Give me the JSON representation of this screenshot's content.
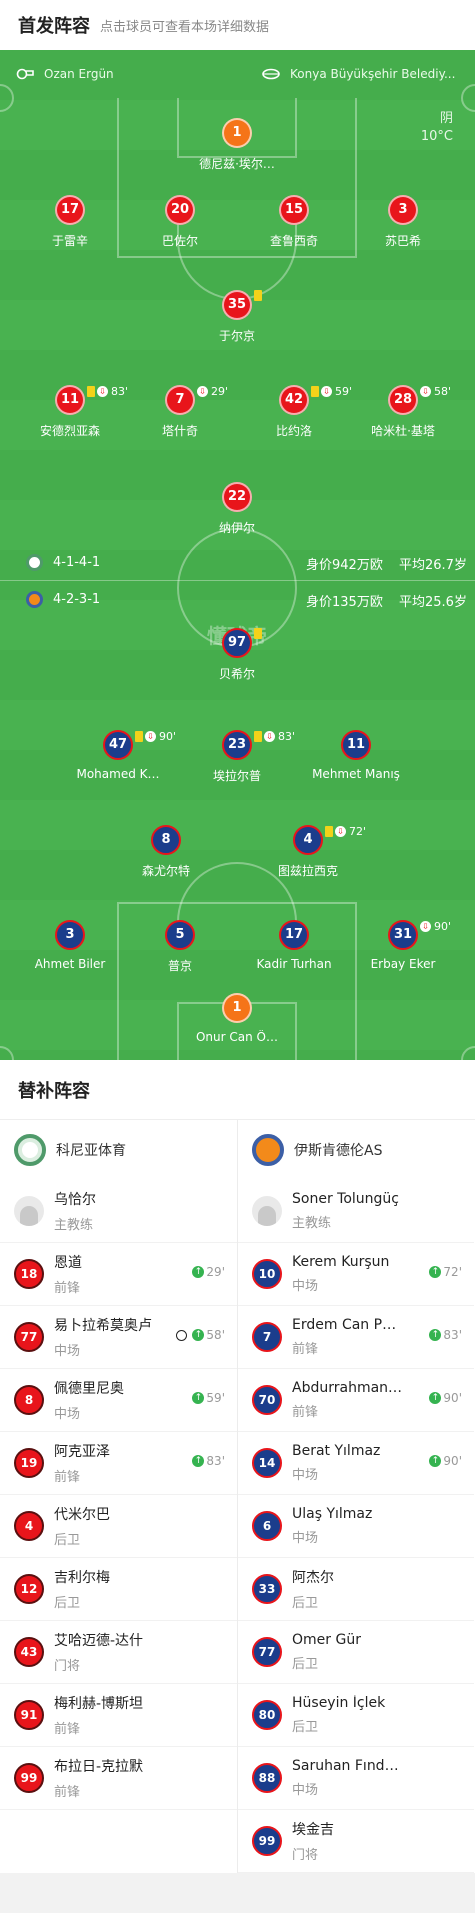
{
  "header": {
    "title": "首发阵容",
    "subtitle": "点击球员可查看本场详细数据"
  },
  "pitch": {
    "home_coach": "Ozan Ergün",
    "away_coach": "Konya Büyükşehir Belediy...",
    "weather": "阴",
    "temperature": "10°C",
    "watermark": "懂球帝",
    "home_formation": "4-1-4-1",
    "home_value": "身价942万欧",
    "home_age": "平均26.7岁",
    "away_formation": "4-2-3-1",
    "away_value": "身价135万欧",
    "away_age": "平均25.6岁"
  },
  "lineup": {
    "home_players": [
      {
        "number": "1",
        "name": "德尼兹·埃尔…",
        "team": "orange"
      },
      {
        "number": "17",
        "name": "于雷辛",
        "team": "red"
      },
      {
        "number": "20",
        "name": "巴佐尔",
        "team": "red"
      },
      {
        "number": "15",
        "name": "查鲁西奇",
        "team": "red",
        "goal": true
      },
      {
        "number": "3",
        "name": "苏巴希",
        "team": "red"
      },
      {
        "number": "35",
        "name": "于尔京",
        "team": "red",
        "yellow": true
      },
      {
        "number": "11",
        "name": "安德烈亚森",
        "team": "red",
        "yellow": true,
        "sub_off": "83'"
      },
      {
        "number": "7",
        "name": "塔什奇",
        "team": "red",
        "sub_off": "29'"
      },
      {
        "number": "42",
        "name": "比约洛",
        "team": "red",
        "yellow": true,
        "sub_off": "59'"
      },
      {
        "number": "28",
        "name": "哈米杜·基塔",
        "team": "red",
        "sub_off": "58'"
      },
      {
        "number": "22",
        "name": "纳伊尔",
        "team": "red",
        "goal": true
      }
    ],
    "away_players": [
      {
        "number": "97",
        "name": "贝希尔",
        "team": "blue",
        "yellow": true
      },
      {
        "number": "47",
        "name": "Mohamed K…",
        "team": "blue",
        "yellow": true,
        "sub_off": "90'"
      },
      {
        "number": "23",
        "name": "埃拉尔普",
        "team": "blue",
        "yellow": true,
        "sub_off": "83'"
      },
      {
        "number": "11",
        "name": "Mehmet Manış",
        "team": "blue"
      },
      {
        "number": "8",
        "name": "森尤尔特",
        "team": "blue"
      },
      {
        "number": "4",
        "name": "图兹拉西克",
        "team": "blue",
        "yellow": true,
        "sub_off": "72'"
      },
      {
        "number": "3",
        "name": "Ahmet Biler",
        "team": "blue"
      },
      {
        "number": "5",
        "name": "普京",
        "team": "blue"
      },
      {
        "number": "17",
        "name": "Kadir Turhan",
        "team": "blue"
      },
      {
        "number": "31",
        "name": "Erbay Eker",
        "team": "blue",
        "sub_off": "90'"
      },
      {
        "number": "1",
        "name": "Onur Can Ö…",
        "team": "orange"
      }
    ]
  },
  "subs": {
    "title": "替补阵容",
    "home": {
      "team_name": "科尼亚体育",
      "coach": {
        "name": "乌恰尔",
        "role": "主教练"
      },
      "players": [
        {
          "number": "18",
          "name": "恩道",
          "position": "前锋",
          "sub_in": "29'"
        },
        {
          "number": "77",
          "name": "易卜拉希莫奥卢",
          "position": "中场",
          "sub_in": "58'",
          "goal": true
        },
        {
          "number": "8",
          "name": "佩德里尼奥",
          "position": "中场",
          "sub_in": "59'"
        },
        {
          "number": "19",
          "name": "阿克亚泽",
          "position": "前锋",
          "sub_in": "83'"
        },
        {
          "number": "4",
          "name": "代米尔巴",
          "position": "后卫"
        },
        {
          "number": "12",
          "name": "吉利尔梅",
          "position": "后卫"
        },
        {
          "number": "43",
          "name": "艾哈迈德-达什",
          "position": "门将"
        },
        {
          "number": "91",
          "name": "梅利赫-博斯坦",
          "position": "前锋"
        },
        {
          "number": "99",
          "name": "布拉日-克拉默",
          "position": "前锋"
        }
      ]
    },
    "away": {
      "team_name": "伊斯肯德伦AS",
      "coach": {
        "name": "Soner Tolungüç",
        "role": "主教练"
      },
      "players": [
        {
          "number": "10",
          "name": "Kerem Kurşun",
          "position": "中场",
          "sub_in": "72'"
        },
        {
          "number": "7",
          "name": "Erdem Can P…",
          "position": "前锋",
          "sub_in": "83'"
        },
        {
          "number": "70",
          "name": "Abdurrahman…",
          "position": "前锋",
          "sub_in": "90'"
        },
        {
          "number": "14",
          "name": "Berat Yılmaz",
          "position": "中场",
          "sub_in": "90'"
        },
        {
          "number": "6",
          "name": "Ulaş Yılmaz",
          "position": "中场"
        },
        {
          "number": "33",
          "name": "阿杰尔",
          "position": "后卫"
        },
        {
          "number": "77",
          "name": "Ömer Gür",
          "position": "后卫"
        },
        {
          "number": "80",
          "name": "Hüseyin İçlek",
          "position": "后卫"
        },
        {
          "number": "88",
          "name": "Saruhan Fınd…",
          "position": "中场"
        },
        {
          "number": "99",
          "name": "埃金吉",
          "position": "门将"
        }
      ]
    }
  },
  "colors": {
    "pitch": "#45ad4c",
    "home": "#e8151b",
    "away": "#1b3d8c",
    "keeper": "#f57418"
  }
}
